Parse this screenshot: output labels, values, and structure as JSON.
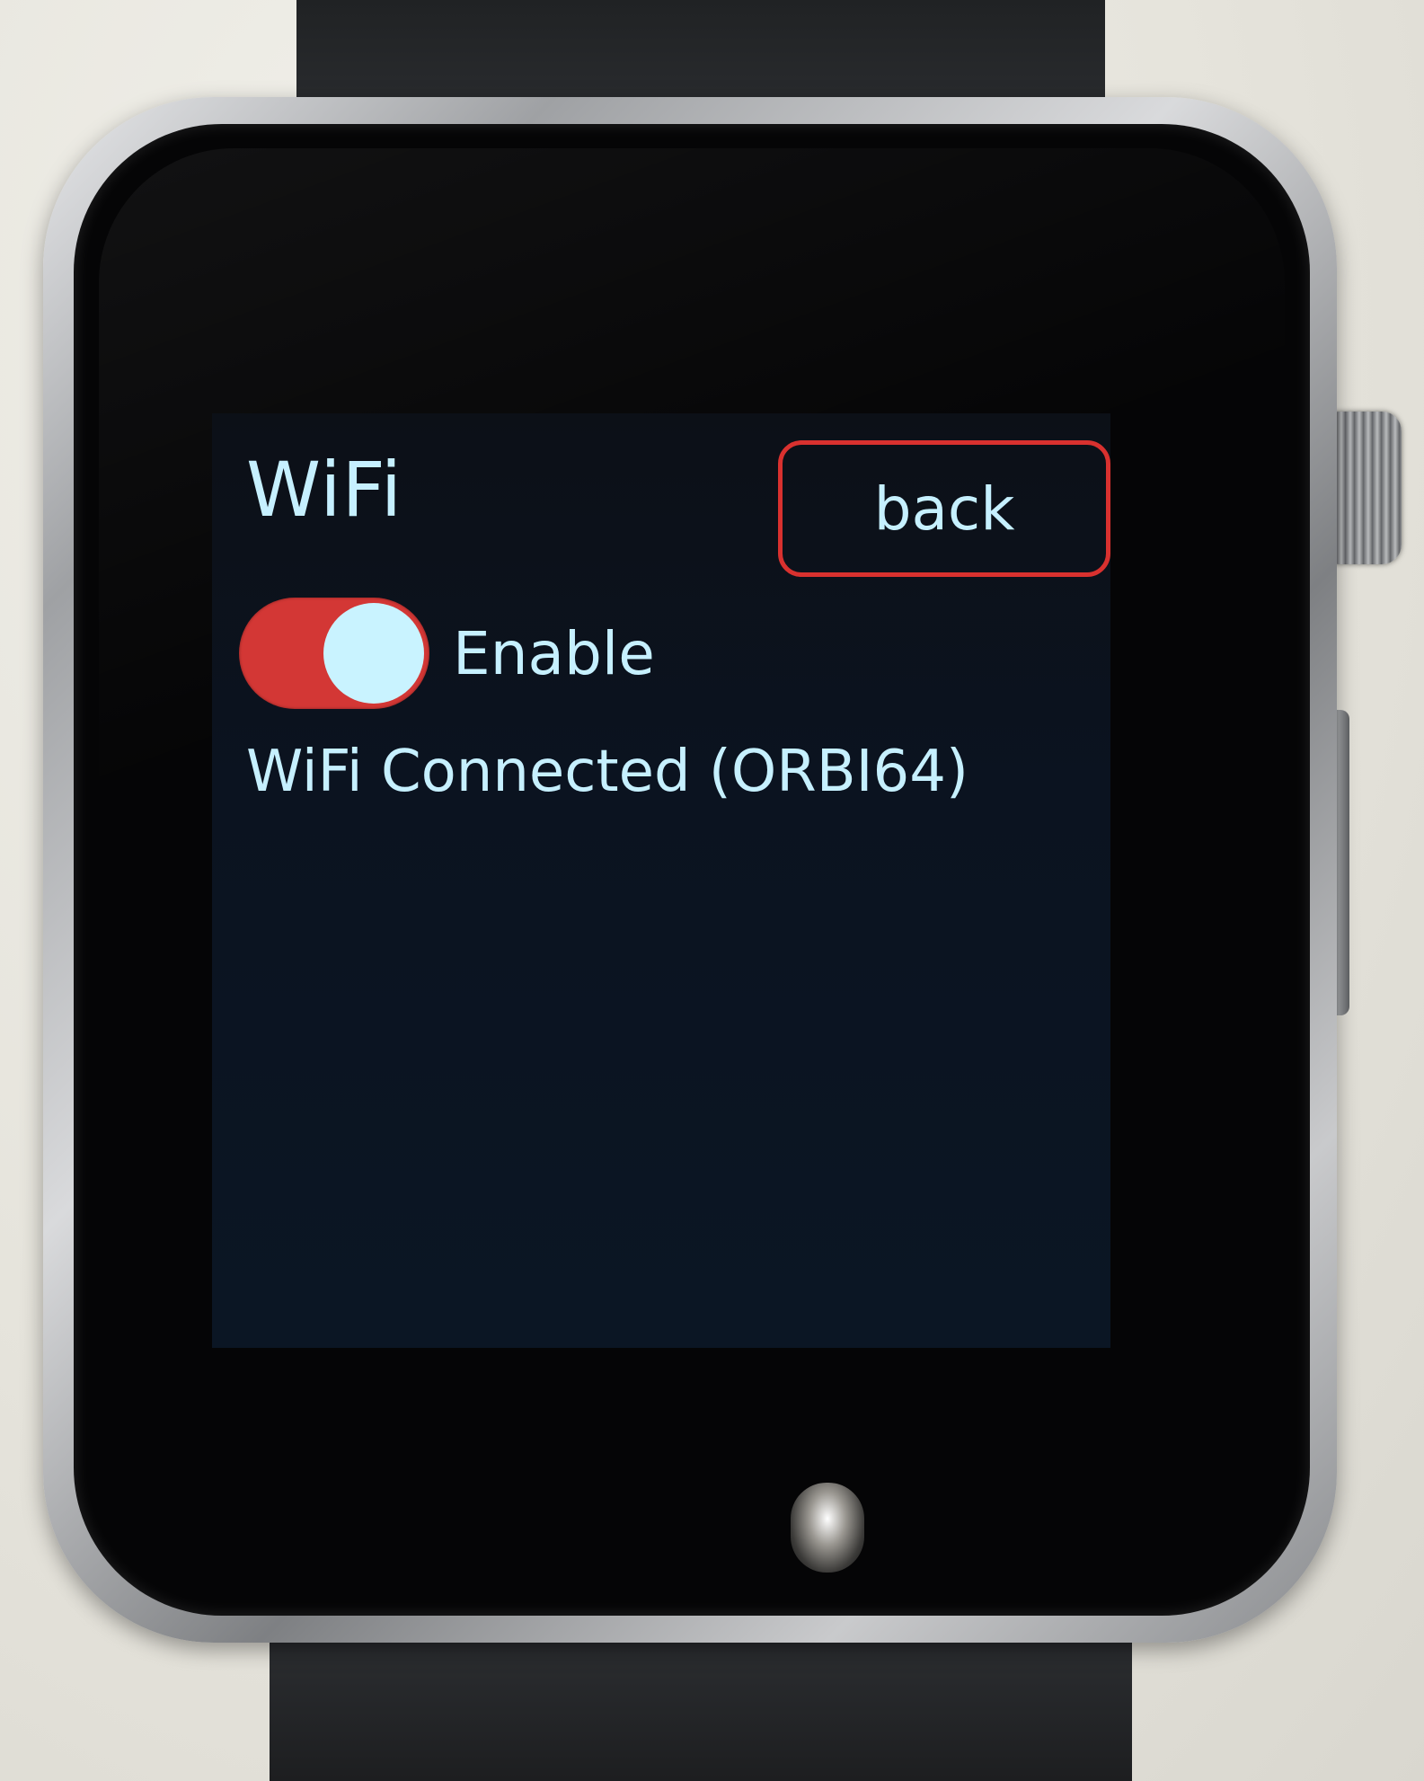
{
  "screen": {
    "title": "WiFi",
    "back_label": "back",
    "toggle": {
      "label": "Enable",
      "state": "on",
      "color": "#d33735"
    },
    "status": "WiFi Connected (ORBI64)"
  },
  "colors": {
    "text": "#c6f0ff",
    "accent": "#d9312f",
    "background": "#0b1320"
  }
}
